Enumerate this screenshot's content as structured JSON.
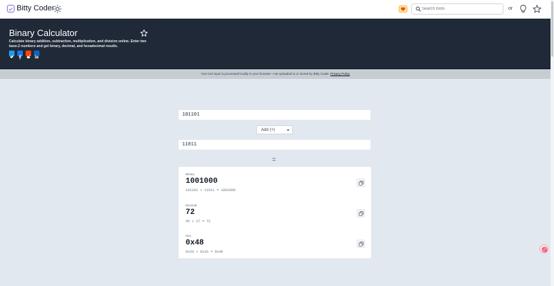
{
  "nav": {
    "brand": "Bitty Coder",
    "search_placeholder": "Search tools",
    "or_label": "or"
  },
  "hero": {
    "title": "Binary Calculator",
    "description": "Calculate binary addition, subtraction, multiplication, and division online. Enter two base-2 numbers and get binary, decimal, and hexadecimal results.",
    "share": [
      "twitter-icon",
      "facebook-icon",
      "reddit-icon",
      "linkedin-icon"
    ]
  },
  "privacy": {
    "text": "Your tool input is processed locally in your browser—not uploaded to or stored by Bitty Coder.",
    "link": "Privacy Policy"
  },
  "calculator": {
    "first_value": "101101",
    "operation": "Add (+)",
    "second_value": "11011",
    "equals": "="
  },
  "results": [
    {
      "label": "Binary",
      "value": "1001000",
      "expr": "101101 + 11011 = 1001000"
    },
    {
      "label": "Decimal",
      "value": "72",
      "expr": "45 + 27 = 72"
    },
    {
      "label": "Hex",
      "value": "0x48",
      "expr": "0x2d + 0x1b = 0x48"
    }
  ],
  "colors": {
    "hero_bg": "#1f2937",
    "page_bg": "#e2e8f0",
    "privacy_bg": "#c7ccd3",
    "accent": "#7c6fd9",
    "twitter": "#1d9bf0",
    "facebook": "#1877f2",
    "reddit": "#ff4500",
    "linkedin": "#0a66c2"
  }
}
